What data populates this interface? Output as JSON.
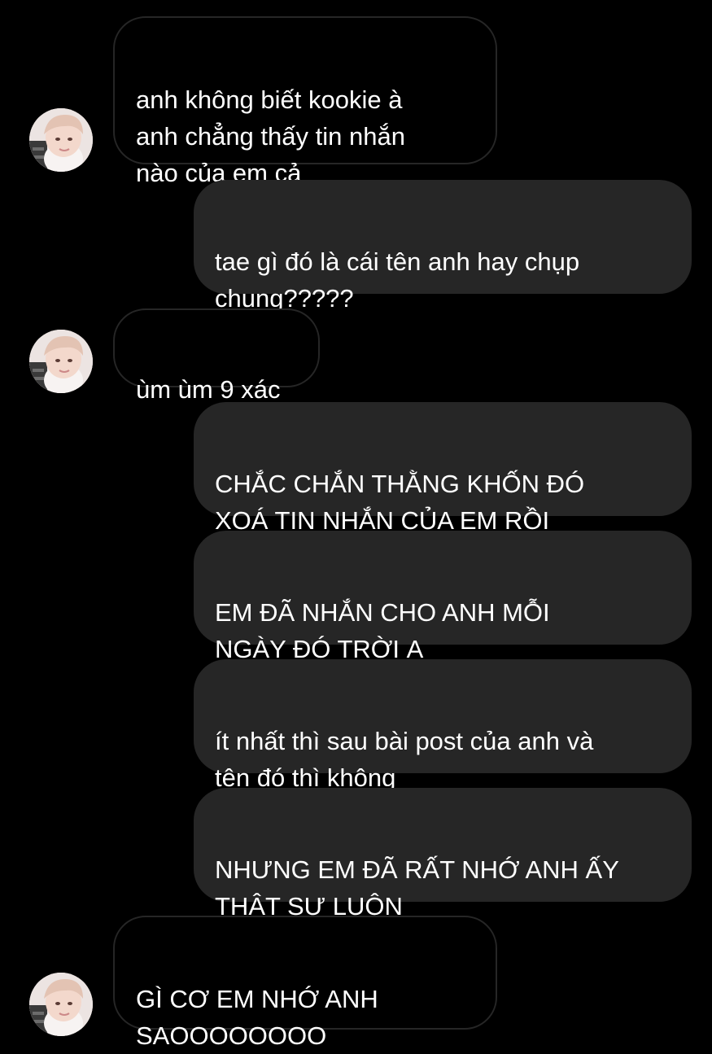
{
  "colors": {
    "background": "#000000",
    "incoming_bubble_border": "#262626",
    "outgoing_bubble_fill": "#262626",
    "text": "#ffffff"
  },
  "messages": [
    {
      "direction": "incoming",
      "text": "anh không biết kookie à\nanh chẳng thấy tin nhắn\nnào của em cả",
      "avatar": "profile-photo"
    },
    {
      "direction": "outgoing",
      "text": "tae gì đó là cái tên anh hay chụp\nchung?????"
    },
    {
      "direction": "incoming",
      "text": "ùm ùm 9 xác",
      "avatar": "profile-photo"
    },
    {
      "direction": "outgoing",
      "text": "CHẮC CHẮN THẰNG KHỐN ĐÓ\nXOÁ TIN NHẮN CỦA EM RỒI"
    },
    {
      "direction": "outgoing",
      "text": "EM ĐÃ NHẮN CHO ANH MỖI\nNGÀY ĐÓ TRỜI Ạ"
    },
    {
      "direction": "outgoing",
      "text": "ít nhất thì sau bài post của anh và\ntên đó thì không"
    },
    {
      "direction": "outgoing",
      "text": "NHƯNG EM ĐÃ RẤT NHỚ ANH ẤY\nTHẬT SỰ LUÔN"
    },
    {
      "direction": "incoming",
      "text": "GÌ CƠ EM NHỚ ANH\nSAOOOOOOOO",
      "avatar": "profile-photo"
    }
  ]
}
